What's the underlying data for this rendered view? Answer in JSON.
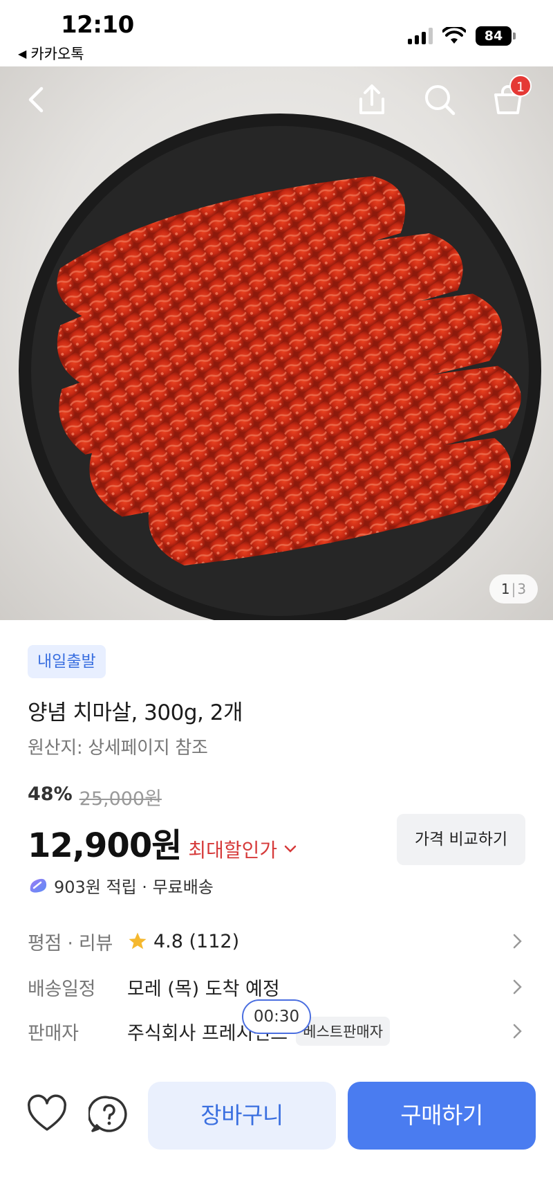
{
  "status_bar": {
    "time": "12:10",
    "back_app": "카카오톡",
    "battery": "84"
  },
  "nav": {
    "cart_count": "1"
  },
  "gallery": {
    "current": "1",
    "separator": "|",
    "total": "3"
  },
  "product": {
    "badge": "내일출발",
    "title": "양념 치마살, 300g, 2개",
    "origin": "원산지: 상세페이지 참조",
    "discount_rate": "48%",
    "original_price": "25,000원",
    "price": "12,900원",
    "max_discount_label": "최대할인가",
    "compare_button": "가격 비교하기",
    "points_text": "903원 적립 · 무료배송"
  },
  "info_rows": {
    "rating": {
      "label": "평점 · 리뷰",
      "value": "4.8 (112)"
    },
    "delivery": {
      "label": "배송일정",
      "value": "모레 (목) 도착 예정"
    },
    "seller": {
      "label": "판매자",
      "value": "주식회사 프레시펀드",
      "badge": "베스트판매자"
    }
  },
  "timer": "00:30",
  "bottom_bar": {
    "cart_label": "장바구니",
    "buy_label": "구매하기"
  },
  "colors": {
    "accent": "#4a7cf0",
    "accent_light": "#eaf0fd",
    "sale_red": "#d63a3a",
    "badge_red": "#e53935",
    "star": "#f5b82e"
  },
  "icons": [
    "back-arrow-icon",
    "share-icon",
    "search-icon",
    "shopping-bag-icon",
    "chevron-down-icon",
    "point-icon",
    "star-icon",
    "chevron-right-icon",
    "heart-icon",
    "question-icon"
  ]
}
